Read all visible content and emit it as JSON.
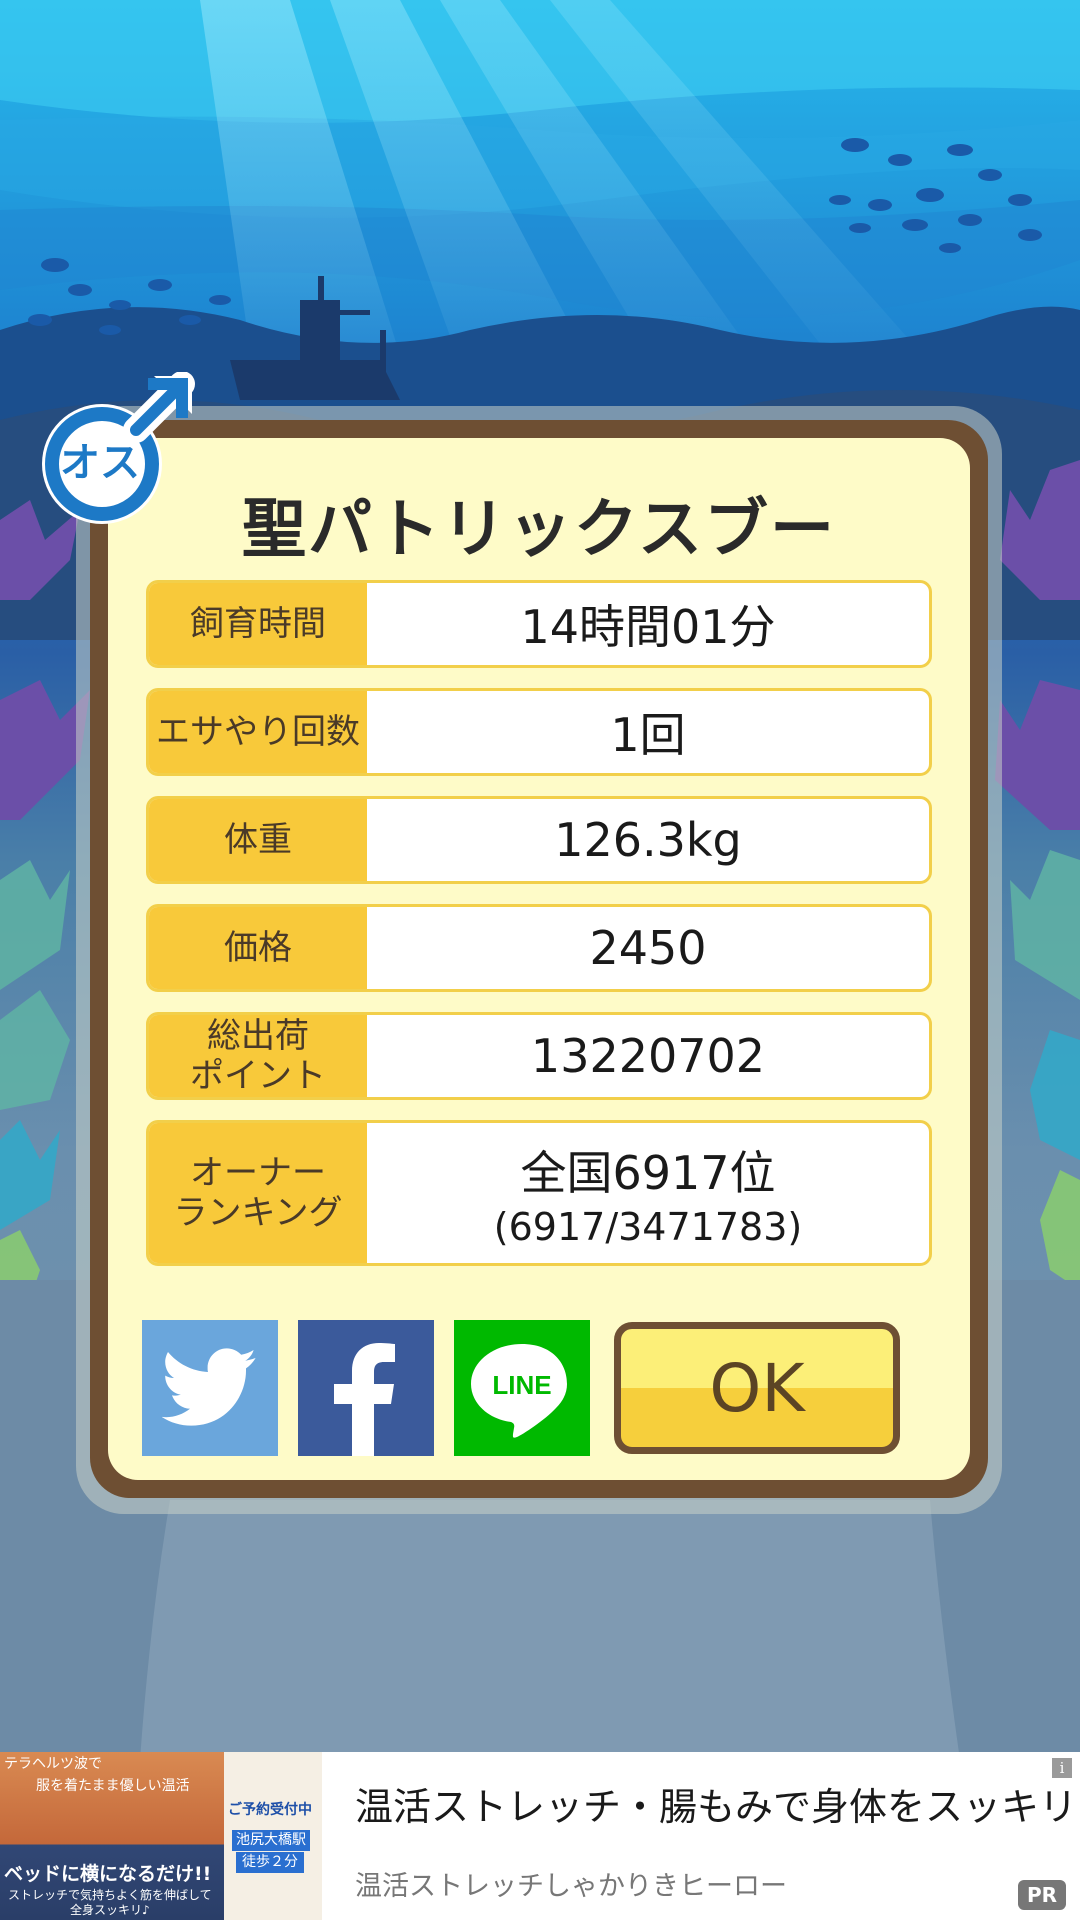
{
  "badge": {
    "label": "オス"
  },
  "dialog": {
    "title": "聖パトリックスブー",
    "rows": [
      {
        "label": "飼育時間",
        "value": "14時間01分"
      },
      {
        "label": "エサやり回数",
        "value": "1回"
      },
      {
        "label": "体重",
        "value": "126.3kg"
      },
      {
        "label": "価格",
        "value": "2450"
      },
      {
        "label_line1": "総出荷",
        "label_line2": "ポイント",
        "value": "13220702"
      },
      {
        "label_line1": "オーナー",
        "label_line2": "ランキング",
        "value": "全国6917位",
        "value_sub": "(6917/3471783)"
      }
    ],
    "buttons": {
      "line_label": "LINE",
      "ok_label": "OK"
    }
  },
  "ad": {
    "image_text": {
      "top_line1": "テラヘルツ波で",
      "top_line2": "服を着たまま優しい温活",
      "right_badge1": "ご予約受付中",
      "right_badge2": "池尻大橋駅",
      "right_badge3": "徒歩２分",
      "bottom_line1": "ベッドに横になるだけ!!",
      "bottom_line2": "ストレッチで気持ちよく筋を伸ばして",
      "bottom_line3": "全身スッキリ♪"
    },
    "headline": "温活ストレッチ・腸もみで身体をスッキリ",
    "advertiser": "温活ストレッチしゃかりきヒーロー",
    "pr_label": "PR",
    "info_label": "i"
  },
  "colors": {
    "label_bg": "#f8c93a",
    "dialog_bg": "#fefbc8",
    "dialog_border": "#6e4f33",
    "twitter": "#6aa6dc",
    "facebook": "#3b5a9b",
    "line": "#00b900"
  }
}
